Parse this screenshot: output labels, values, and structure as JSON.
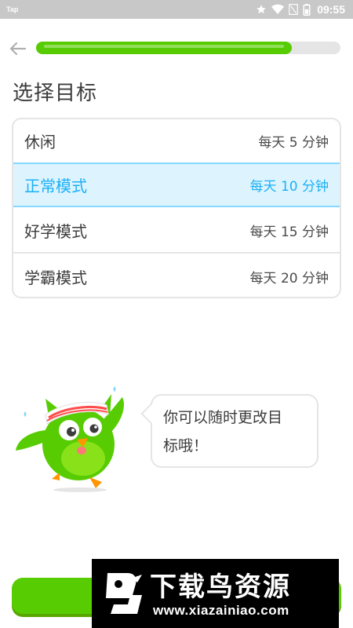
{
  "status_bar": {
    "app_label": "Tap",
    "time": "09:55",
    "icons": [
      "star-icon",
      "wifi-icon",
      "signal-off-icon",
      "battery-icon"
    ]
  },
  "header": {
    "progress": 0.84
  },
  "title": "选择目标",
  "goals": [
    {
      "name": "休闲",
      "time": "每天 5 分钟",
      "selected": false
    },
    {
      "name": "正常模式",
      "time": "每天 10 分钟",
      "selected": true
    },
    {
      "name": "好学模式",
      "time": "每天 15 分钟",
      "selected": false
    },
    {
      "name": "学霸模式",
      "time": "每天 20 分钟",
      "selected": false
    }
  ],
  "speech": {
    "line1": "你可以随时更改目",
    "line2": "标哦！"
  },
  "watermark": {
    "title": "下载鸟资源",
    "url": "www.xiazainiao.com"
  },
  "colors": {
    "green": "#58cc02",
    "blue": "#1cb0f6",
    "selected_bg": "#ddf4ff",
    "border": "#e5e5e5"
  }
}
